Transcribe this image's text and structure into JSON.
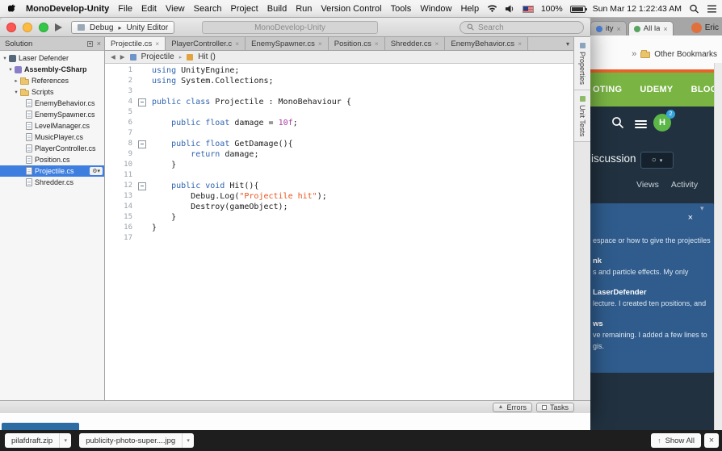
{
  "colors": {
    "green": "#7ab544",
    "orange": "#e8622c",
    "navy": "#21313f",
    "panel": "#2f5c8d",
    "selection": "#3d7edf",
    "keyword": "#2f63b0",
    "string": "#e8551c",
    "number": "#a93ba0",
    "avatar": "#5cb648",
    "badge": "#35a3dc",
    "profile": "#e0703c"
  },
  "icons": {
    "close": "×",
    "caret_down": "▾",
    "caret_right": "▸",
    "expander_open": "▾",
    "expander_closed": "▸",
    "back": "◀",
    "forward": "▶",
    "gear": "⚙",
    "chevrons_right": "»",
    "up_arrow": "↑",
    "errors_triangle": "▲",
    "circle": "○"
  },
  "menubar": {
    "app_name": "MonoDevelop-Unity",
    "menus": [
      "File",
      "Edit",
      "View",
      "Search",
      "Project",
      "Build",
      "Run",
      "Version Control",
      "Tools",
      "Window",
      "Help"
    ],
    "battery": "100%",
    "clock": "Sun Mar 12 1:22:43 AM"
  },
  "monodevelop": {
    "toolbar": {
      "debug_label": "Debug",
      "target_label": "Unity Editor",
      "title": "MonoDevelop-Unity",
      "search_placeholder": "Search"
    },
    "solution_panel": {
      "title": "Solution",
      "tree": [
        {
          "label": "Laser Defender",
          "indent": 0,
          "exp": "open",
          "icon": "solution"
        },
        {
          "label": "Assembly-CSharp",
          "indent": 1,
          "exp": "open",
          "icon": "assembly",
          "bold": true
        },
        {
          "label": "References",
          "indent": 2,
          "exp": "closed",
          "icon": "folder"
        },
        {
          "label": "Scripts",
          "indent": 2,
          "exp": "open",
          "icon": "folder"
        },
        {
          "label": "EnemyBehavior.cs",
          "indent": 3,
          "icon": "file"
        },
        {
          "label": "EnemySpawner.cs",
          "indent": 3,
          "icon": "file"
        },
        {
          "label": "LevelManager.cs",
          "indent": 3,
          "icon": "file"
        },
        {
          "label": "MusicPlayer.cs",
          "indent": 3,
          "icon": "file"
        },
        {
          "label": "PlayerController.cs",
          "indent": 3,
          "icon": "file"
        },
        {
          "label": "Position.cs",
          "indent": 3,
          "icon": "file"
        },
        {
          "label": "Projectile.cs",
          "indent": 3,
          "icon": "file",
          "selected": true
        },
        {
          "label": "Shredder.cs",
          "indent": 3,
          "icon": "file"
        }
      ]
    },
    "tabs": [
      {
        "label": "Projectile.cs",
        "active": true
      },
      {
        "label": "PlayerController.c",
        "active": false
      },
      {
        "label": "EnemySpawner.cs",
        "active": false
      },
      {
        "label": "Position.cs",
        "active": false
      },
      {
        "label": "Shredder.cs",
        "active": false
      },
      {
        "label": "EnemyBehavior.cs",
        "active": false
      }
    ],
    "breadcrumb": {
      "class_name": "Projectile",
      "member": "Hit ()"
    },
    "editor": {
      "lines": [
        {
          "t": [
            [
              "kw",
              "using"
            ],
            [
              "pl",
              " UnityEngine;"
            ]
          ]
        },
        {
          "t": [
            [
              "kw",
              "using"
            ],
            [
              "pl",
              " System.Collections;"
            ]
          ]
        },
        {
          "t": []
        },
        {
          "f": true,
          "t": [
            [
              "kw",
              "public class"
            ],
            [
              "pl",
              " Projectile : MonoBehaviour {"
            ]
          ]
        },
        {
          "t": []
        },
        {
          "t": [
            [
              "pl",
              "    "
            ],
            [
              "kw",
              "public float"
            ],
            [
              "pl",
              " damage = "
            ],
            [
              "nu",
              "10f"
            ],
            [
              "pl",
              ";"
            ]
          ]
        },
        {
          "t": []
        },
        {
          "f": true,
          "t": [
            [
              "pl",
              "    "
            ],
            [
              "kw",
              "public float"
            ],
            [
              "pl",
              " GetDamage(){"
            ]
          ]
        },
        {
          "t": [
            [
              "pl",
              "        "
            ],
            [
              "kw",
              "return"
            ],
            [
              "pl",
              " damage;"
            ]
          ]
        },
        {
          "t": [
            [
              "pl",
              "    }"
            ]
          ]
        },
        {
          "t": []
        },
        {
          "f": true,
          "t": [
            [
              "pl",
              "    "
            ],
            [
              "kw",
              "public void"
            ],
            [
              "pl",
              " Hit(){"
            ]
          ]
        },
        {
          "t": [
            [
              "pl",
              "        Debug.Log("
            ],
            [
              "st",
              "\"Projectile hit\""
            ],
            [
              "pl",
              ");"
            ]
          ]
        },
        {
          "t": [
            [
              "pl",
              "        Destroy(gameObject);"
            ]
          ]
        },
        {
          "t": [
            [
              "pl",
              "    }"
            ]
          ]
        },
        {
          "t": [
            [
              "pl",
              "}"
            ]
          ]
        },
        {
          "t": []
        }
      ]
    },
    "right_tabs": [
      "Properties",
      "Unit Tests"
    ],
    "statusbar": {
      "errors": "Errors",
      "tasks": "Tasks"
    }
  },
  "chrome": {
    "tabs": [
      {
        "label": "ity",
        "favicon_color": "#4a7fd4",
        "active": false
      },
      {
        "label": "All la",
        "favicon_color": "#58a35f",
        "active": true
      }
    ],
    "profile_name": "Eric",
    "bookmarks_label": "Other Bookmarks",
    "nav_items": [
      "OTING",
      "UDEMY",
      "BLOG"
    ],
    "avatar_letter": "H",
    "avatar_badge": "2",
    "discussion_label": "iscussion",
    "section_tabs": [
      "Views",
      "Activity"
    ],
    "panel_lines": [
      {
        "text": "espace or how to give the projectiles",
        "bold": false
      },
      {
        "text": "nk",
        "bold": true
      },
      {
        "text": "s and particle effects. My only",
        "bold": false
      },
      {
        "text": "LaserDefender",
        "bold": true
      },
      {
        "text": "lecture. I created ten positions, and",
        "bold": false
      },
      {
        "text": "ws",
        "bold": true
      },
      {
        "text": "ve remaining. I added a few lines to",
        "bold": false
      },
      {
        "text": "gis.",
        "bold": false
      }
    ]
  },
  "downloads": {
    "items": [
      {
        "name": "pilafdraft.zip"
      },
      {
        "name": "publicity-photo-super....jpg"
      }
    ],
    "show_all_label": "Show All"
  }
}
